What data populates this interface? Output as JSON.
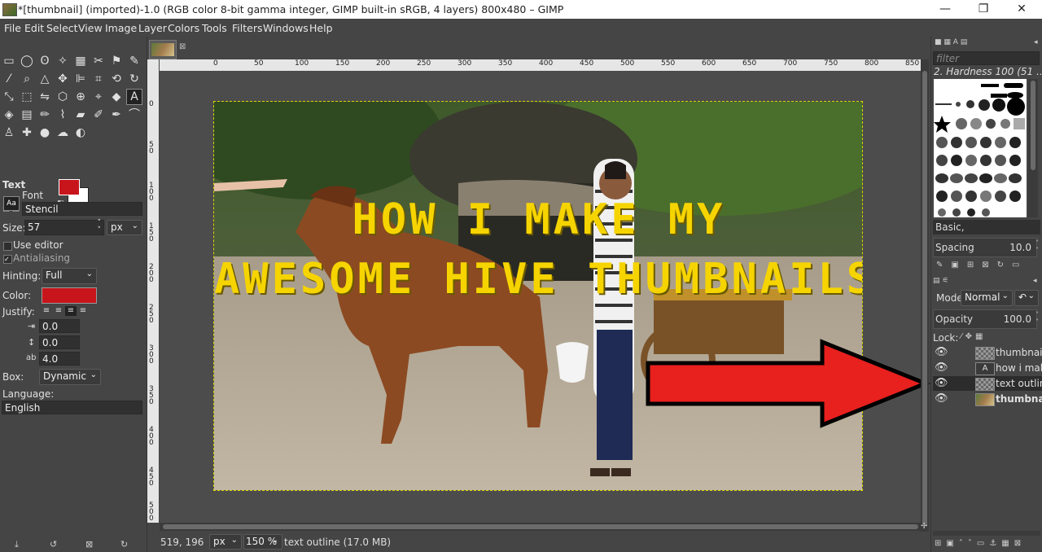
{
  "window": {
    "title": "*[thumbnail] (imported)-1.0 (RGB color 8-bit gamma integer, GIMP built-in sRGB, 4 layers) 800x480 – GIMP",
    "minimize": "—",
    "maximize": "❐",
    "close": "✕"
  },
  "menu": [
    "File",
    "Edit",
    "Select",
    "View",
    "Image",
    "Layer",
    "Colors",
    "Tools",
    "Filters",
    "Windows",
    "Help"
  ],
  "tool_options": {
    "heading": "Text",
    "font_label": "Font",
    "font_value": "Stencil",
    "size_label": "Size:",
    "size_value": "57",
    "size_unit": "px",
    "use_editor": "Use editor",
    "antialiasing": "Antialiasing",
    "hinting_label": "Hinting:",
    "hinting_value": "Full",
    "color_label": "Color:",
    "text_color": "#c8151c",
    "justify_label": "Justify:",
    "indent": "0.0",
    "line_spacing": "0.0",
    "letter_spacing": "4.0",
    "box_label": "Box:",
    "box_value": "Dynamic",
    "language_label": "Language:",
    "language_value": "English"
  },
  "canvas": {
    "ruler_top": [
      "0",
      "50",
      "100",
      "150",
      "200",
      "250",
      "300",
      "350",
      "400",
      "450",
      "500",
      "550",
      "600",
      "650",
      "700",
      "750",
      "800",
      "850"
    ],
    "ruler_left": [
      "0",
      "50",
      "100",
      "150",
      "200",
      "250",
      "300",
      "350",
      "400",
      "450",
      "500"
    ],
    "text_line1": "HOW I MAKE MY",
    "text_line2": "AWESOME HIVE THUMBNAILS",
    "text_color": "#f6d400"
  },
  "status": {
    "coords": "519, 196",
    "unit": "px",
    "zoom": "150 %",
    "message": "text outline (17.0 MB)"
  },
  "brushes": {
    "filter_placeholder": "filter",
    "current_brush": "2. Hardness 100 (51 …",
    "preset": "Basic,",
    "spacing_label": "Spacing",
    "spacing_value": "10.0"
  },
  "layers": {
    "mode_label": "Mode",
    "mode_value": "Normal",
    "opacity_label": "Opacity",
    "opacity_value": "100.0",
    "lock_label": "Lock:",
    "items": [
      {
        "name": "thumbnail"
      },
      {
        "name": "how i make"
      },
      {
        "name": "text outline"
      },
      {
        "name": "thumbnail"
      }
    ]
  }
}
